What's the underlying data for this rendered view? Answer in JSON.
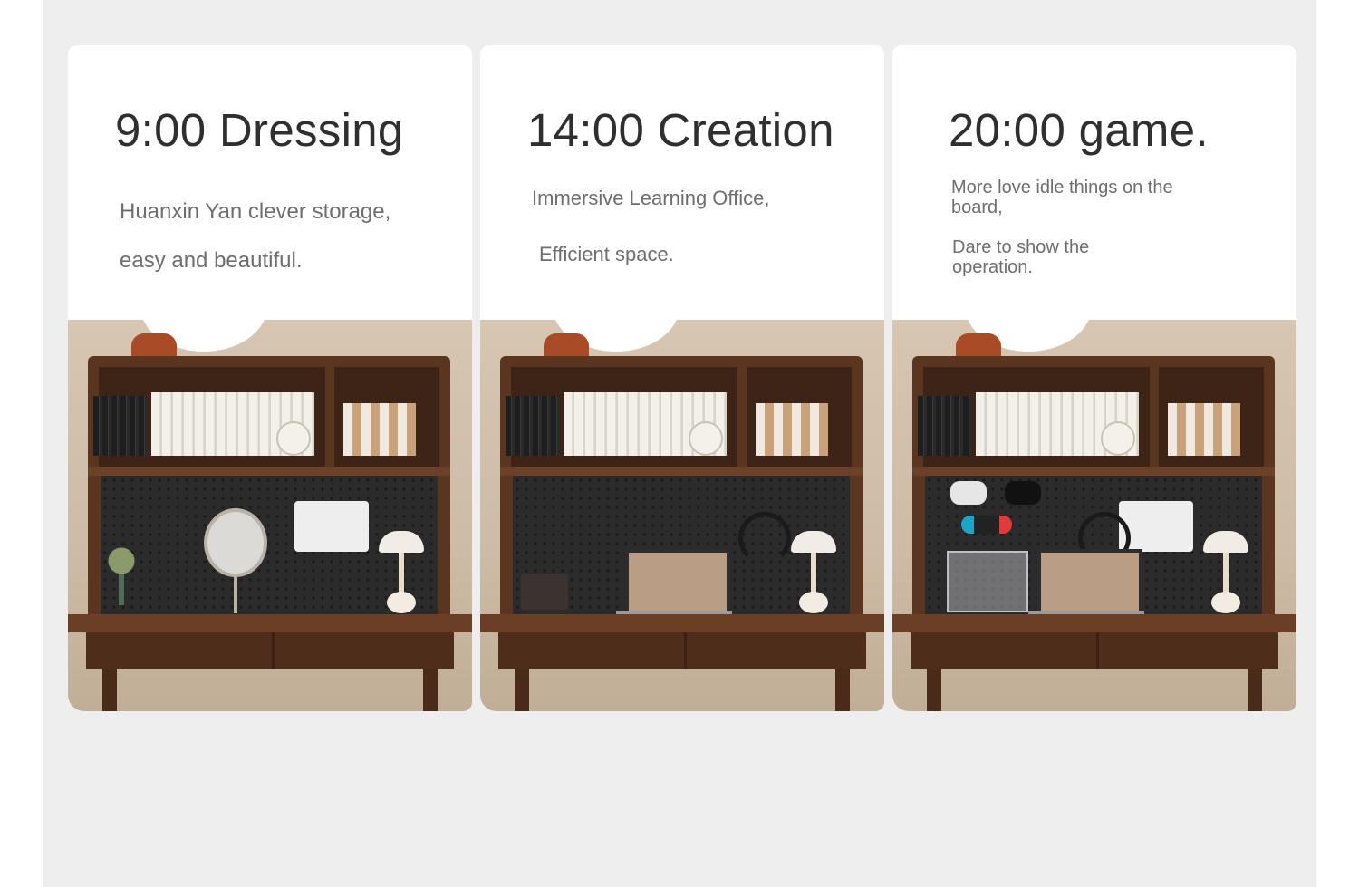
{
  "cards": [
    {
      "title": "9:00 Dressing",
      "description": "Huanxin Yan clever storage, easy and beautiful."
    },
    {
      "title": "14:00 Creation",
      "description_lines": [
        "Immersive Learning Office,",
        "Efficient space."
      ]
    },
    {
      "title": "20:00 game.",
      "paragraphs": [
        "More love idle things on the board,",
        "Dare to show the operation."
      ]
    }
  ],
  "colors": {
    "page_background": "#efeeee",
    "card_background": "#ffffff",
    "title_text": "#2f2f2f",
    "body_text": "#6e6e6e",
    "wood": "#5a3520",
    "pegboard": "#2b2b2c"
  }
}
